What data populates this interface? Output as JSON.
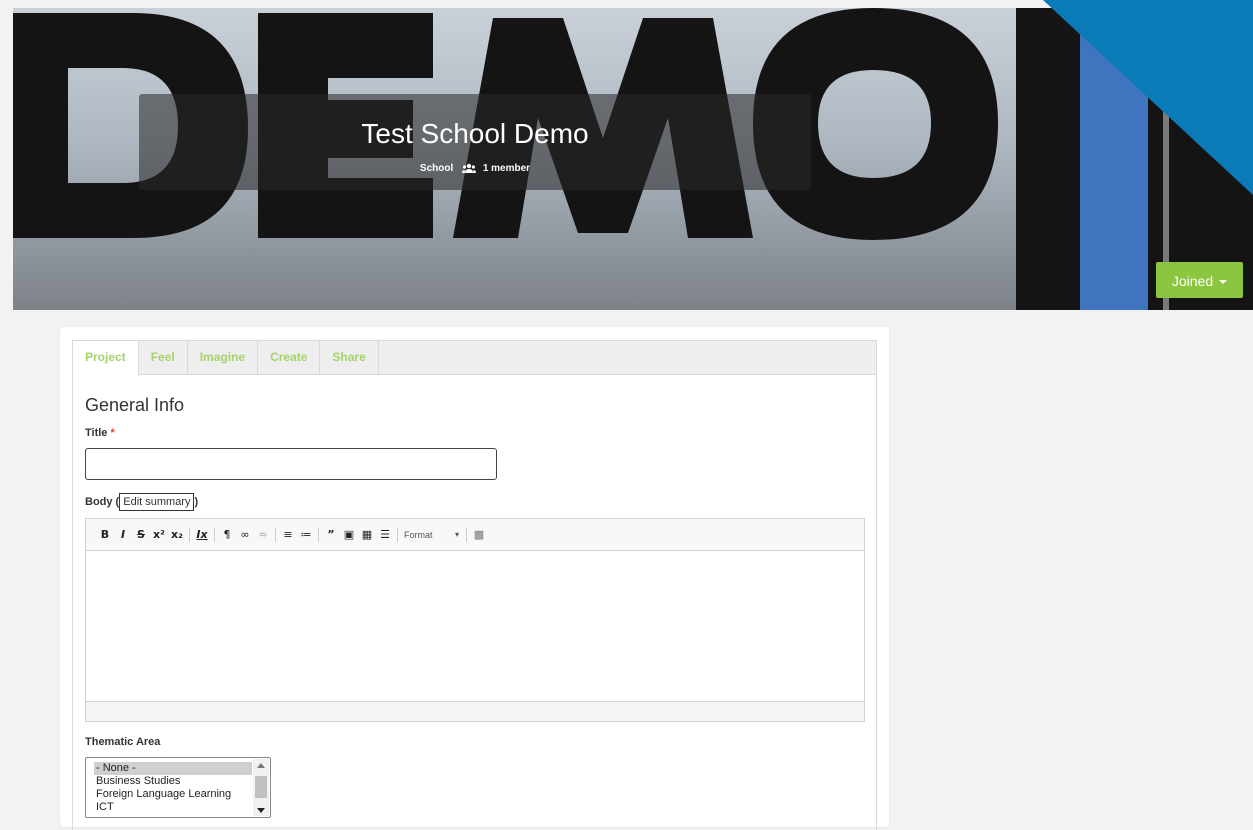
{
  "hero": {
    "background_text": "DEMO",
    "title": "Test School Demo",
    "group_type": "School",
    "members": "1 member",
    "joined_label": "Joined",
    "accent_color": "#8cc63f",
    "ribbon_color": "#0b7bb8"
  },
  "tabs": [
    {
      "label": "Project",
      "active": true
    },
    {
      "label": "Feel",
      "active": false
    },
    {
      "label": "Imagine",
      "active": false
    },
    {
      "label": "Create",
      "active": false
    },
    {
      "label": "Share",
      "active": false
    }
  ],
  "form": {
    "section_title": "General Info",
    "title_label": "Title",
    "required_mark": "*",
    "title_value": "",
    "body_label_prefix": "Body (",
    "edit_summary_label": "Edit summary",
    "body_label_suffix": ")",
    "editor_toolbar": {
      "bold": "B",
      "italic": "I",
      "strike": "S",
      "superscript": "x²",
      "subscript": "x₂",
      "remove_format": "Ix",
      "format_combo": "Format"
    },
    "thematic_label": "Thematic Area",
    "thematic_options": [
      "- None -",
      "Business Studies",
      "Foreign Language Learning",
      "ICT"
    ],
    "thematic_selected": "- None -"
  }
}
